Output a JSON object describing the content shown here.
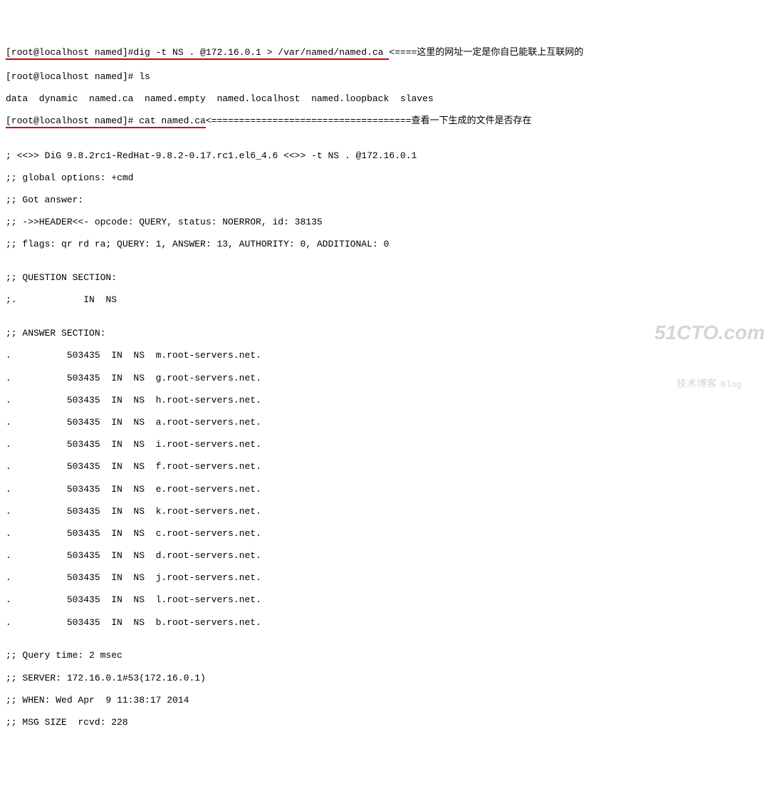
{
  "line1": {
    "prompt_cmd": "[root@localhost named]#dig -t NS . @172.16.0.1 > /var/named/named.ca ",
    "annotation": "<====这里的网址一定是你自已能联上互联网的"
  },
  "line2": "[root@localhost named]# ls",
  "line3": "data  dynamic  named.ca  named.empty  named.localhost  named.loopback  slaves",
  "line4": {
    "prompt_cmd": "[root@localhost named]# cat named.ca",
    "annotation": "<====================================查看一下生成的文件是否存在"
  },
  "blank1": "",
  "dig_header1": "; <<>> DiG 9.8.2rc1-RedHat-9.8.2-0.17.rc1.el6_4.6 <<>> -t NS . @172.16.0.1",
  "dig_header2": ";; global options: +cmd",
  "dig_header3": ";; Got answer:",
  "dig_header4": ";; ->>HEADER<<- opcode: QUERY, status: NOERROR, id: 38135",
  "dig_header5": ";; flags: qr rd ra; QUERY: 1, ANSWER: 13, AUTHORITY: 0, ADDITIONAL: 0",
  "blank2": "",
  "question_section_hdr": ";; QUESTION SECTION:",
  "question_row": ";.            IN  NS",
  "blank3": "",
  "answer_section_hdr": ";; ANSWER SECTION:",
  "answers": [
    ".          503435  IN  NS  m.root-servers.net.",
    ".          503435  IN  NS  g.root-servers.net.",
    ".          503435  IN  NS  h.root-servers.net.",
    ".          503435  IN  NS  a.root-servers.net.",
    ".          503435  IN  NS  i.root-servers.net.",
    ".          503435  IN  NS  f.root-servers.net.",
    ".          503435  IN  NS  e.root-servers.net.",
    ".          503435  IN  NS  k.root-servers.net.",
    ".          503435  IN  NS  c.root-servers.net.",
    ".          503435  IN  NS  d.root-servers.net.",
    ".          503435  IN  NS  j.root-servers.net.",
    ".          503435  IN  NS  l.root-servers.net.",
    ".          503435  IN  NS  b.root-servers.net."
  ],
  "blank4": "",
  "footer1": ";; Query time: 2 msec",
  "footer2": ";; SERVER: 172.16.0.1#53(172.16.0.1)",
  "footer3": ";; WHEN: Wed Apr  9 11:38:17 2014",
  "footer4": ";; MSG SIZE  rcvd: 228",
  "watermark": {
    "top": "51CTO.com",
    "bottom": "技术博客",
    "blog": "Blog"
  }
}
